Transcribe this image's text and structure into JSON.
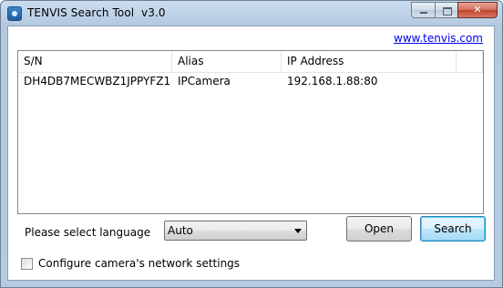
{
  "window": {
    "title": "TENVIS Search Tool  v3.0",
    "icon": "app-camera-icon",
    "caption_buttons": {
      "minimize": "minimize-icon",
      "maximize": "maximize-icon",
      "close": "close-icon"
    }
  },
  "header": {
    "link_text": "www.tenvis.com"
  },
  "device_list": {
    "columns": [
      "S/N",
      "Alias",
      "IP Address"
    ],
    "rows": [
      {
        "sn": "DH4DB7MECWBZ1JPPYFZ1",
        "alias": "IPCamera",
        "ip": "192.168.1.88:80"
      }
    ]
  },
  "language": {
    "label": "Please select language",
    "selected": "Auto"
  },
  "buttons": {
    "open": "Open",
    "search": "Search"
  },
  "network_settings": {
    "label": "Configure camera's network settings",
    "checked": false
  },
  "colors": {
    "titlebar": "#bfd3e8",
    "close_button": "#c1442c",
    "link": "#0000ee"
  }
}
